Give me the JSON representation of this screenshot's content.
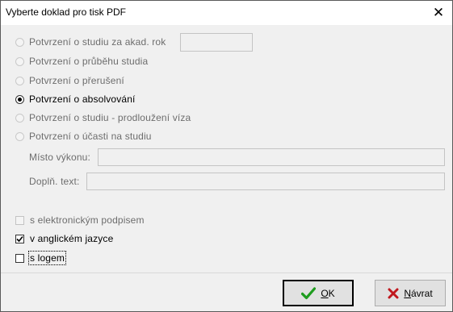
{
  "window": {
    "title": "Vyberte doklad pro tisk PDF",
    "close_glyph": "✕"
  },
  "options": [
    {
      "label": "Potvrzení o studiu za akad. rok",
      "checked": false,
      "enabled": false
    },
    {
      "label": "Potvrzení o průběhu studia",
      "checked": false,
      "enabled": false
    },
    {
      "label": "Potvrzení o přerušení",
      "checked": false,
      "enabled": false
    },
    {
      "label": "Potvrzení o absolvování",
      "checked": true,
      "enabled": true
    },
    {
      "label": "Potvrzení o studiu - prodloužení víza",
      "checked": false,
      "enabled": false
    },
    {
      "label": "Potvrzení o účasti na studiu",
      "checked": false,
      "enabled": false
    }
  ],
  "fields": {
    "akad_rok": {
      "value": ""
    },
    "misto_vykonu": {
      "label": "Místo výkonu:",
      "value": ""
    },
    "dopln_text": {
      "label": "Doplň. text:",
      "value": ""
    }
  },
  "checkboxes": [
    {
      "label": "s elektronickým podpisem",
      "checked": false,
      "enabled": false
    },
    {
      "label": "v anglickém jazyce",
      "checked": true,
      "enabled": true
    },
    {
      "label": "s logem",
      "checked": false,
      "enabled": true
    }
  ],
  "buttons": {
    "ok": {
      "mnemonic": "O",
      "rest": "K",
      "icon": "checkmark-icon",
      "color": "#1f9c1f"
    },
    "navrat": {
      "mnemonic": "N",
      "rest": "ávrat",
      "icon": "x-icon",
      "color": "#c0181e"
    }
  }
}
